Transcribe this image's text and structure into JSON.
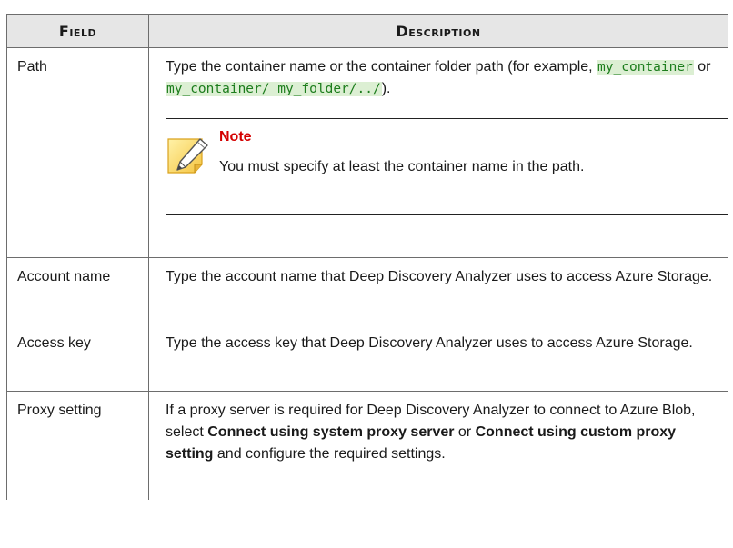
{
  "table": {
    "headers": {
      "field": "Field",
      "description": "Description"
    },
    "rows": {
      "path": {
        "field": "Path",
        "desc_text1": "Type the container name or the container folder path (for example, ",
        "code1": "my_container",
        "desc_text2": " or ",
        "code2": "my_container/ my_folder/../",
        "desc_text3": ").",
        "note": {
          "icon": "note-pencil-icon",
          "title": "Note",
          "body": "You must specify at least the container name in the path."
        }
      },
      "account": {
        "field": "Account name",
        "desc": "Type the account name that Deep Discovery Analyzer uses to access Azure Storage."
      },
      "access": {
        "field": "Access key",
        "desc": "Type the access key that Deep Discovery Analyzer uses to access Azure Storage."
      },
      "proxy": {
        "field": "Proxy setting",
        "desc_text1": "If a proxy server is required for Deep Discovery Analyzer to connect to Azure Blob, select ",
        "bold1": "Connect using system proxy server",
        "desc_text2": " or ",
        "bold2": "Connect using custom proxy setting",
        "desc_text3": " and configure the required settings."
      }
    }
  },
  "colors": {
    "header_bg": "#e6e6e6",
    "note_title": "#d40000",
    "code_bg": "#dcefd3",
    "code_text": "#1d7d1d"
  }
}
